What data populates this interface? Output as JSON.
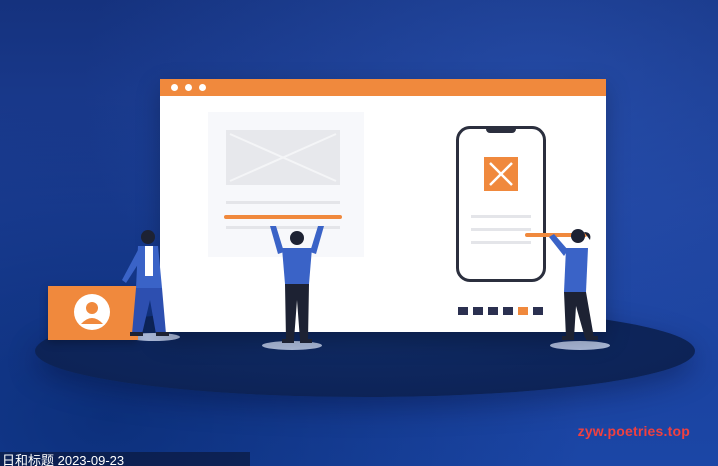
{
  "watermark": "zyw.poetries.top",
  "caption": "日和标题 2023-09-23",
  "colors": {
    "accent": "#f0893d",
    "background": "#1c3f97",
    "floor": "#0d2459",
    "figure_shirt": "#3a63c7",
    "figure_pants": "#1d2233"
  },
  "icons": {
    "card": "user-avatar-icon",
    "image_placeholder": "image-placeholder-icon"
  }
}
